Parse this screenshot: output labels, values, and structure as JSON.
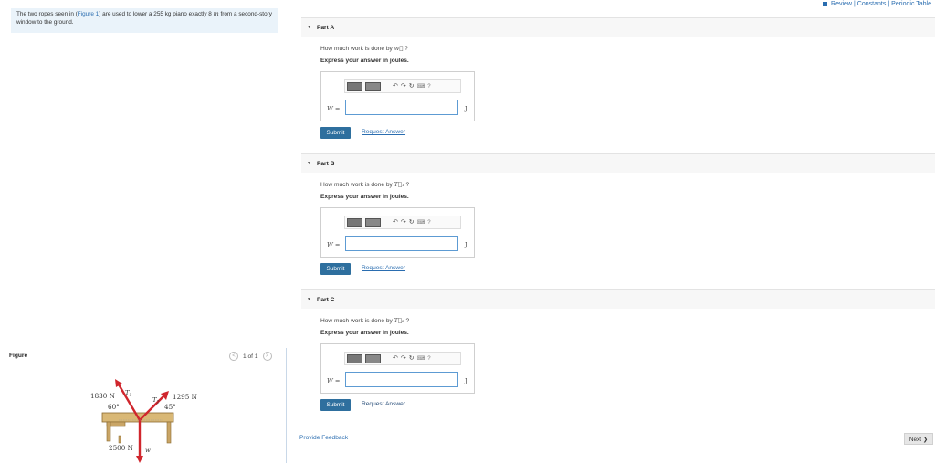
{
  "top_links": {
    "review": "Review",
    "constants": "Constants",
    "periodic": "Periodic Table",
    "sep": "|"
  },
  "problem": {
    "text_before": "The two ropes seen in (",
    "figure_link": "Figure 1",
    "text_middle": ") are used to lower a 255 kg piano exactly 8 ",
    "unit": "m",
    "text_after": " from a second-story window to the ground."
  },
  "figure_panel": {
    "label": "Figure",
    "pager_text": "1 of 1",
    "prev": "<",
    "next": ">"
  },
  "figure": {
    "f1": "1830 N",
    "angle1": "60°",
    "t1": "T",
    "t1_sub": "1",
    "f2": "1295 N",
    "angle2": "45°",
    "t2": "T",
    "t2_sub": "2",
    "weight": "2500 N",
    "w": "w"
  },
  "parts": [
    {
      "title": "Part A",
      "question_prefix": "How much work is done by ",
      "symbol": "w⃗",
      "question_suffix": " ?",
      "express": "Express your answer in joules.",
      "var": "W =",
      "unit": "J",
      "submit": "Submit",
      "request": "Request Answer"
    },
    {
      "title": "Part B",
      "question_prefix": "How much work is done by ",
      "symbol": "T⃗₁",
      "question_suffix": " ?",
      "express": "Express your answer in joules.",
      "var": "W =",
      "unit": "J",
      "submit": "Submit",
      "request": "Request Answer"
    },
    {
      "title": "Part C",
      "question_prefix": "How much work is done by ",
      "symbol": "T⃗₂",
      "question_suffix": " ?",
      "express": "Express your answer in joules.",
      "var": "W =",
      "unit": "J",
      "submit": "Submit",
      "request": "Request Answer"
    }
  ],
  "toolbar": {
    "undo": "↶",
    "redo": "↷",
    "reset": "↻",
    "keyboard": "⌨",
    "help": "?"
  },
  "footer": {
    "feedback": "Provide Feedback",
    "next": "Next ❯"
  },
  "colors": {
    "accent": "#2a6db0",
    "submit_bg": "#2e6f9e",
    "problem_bg": "#eaf3fa",
    "arrow": "#d0262d"
  }
}
